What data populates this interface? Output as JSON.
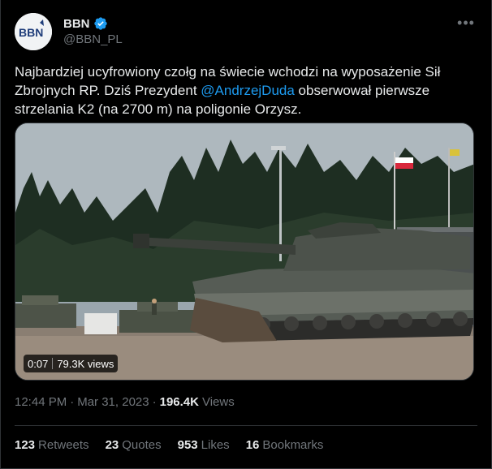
{
  "author": {
    "display_name": "BBN",
    "handle": "@BBN_PL",
    "avatar_text": "BBN"
  },
  "tweet": {
    "text_before": "Najbardziej ucyfrowiony czołg na świecie wchodzi na wyposażenie Sił Zbrojnych RP. Dziś Prezydent ",
    "mention": "@AndrzejDuda",
    "text_after": " obserwował pierwsze strzelania K2 (na 2700 m) na poligonie Orzysz."
  },
  "video": {
    "duration": "0:07",
    "views": "79.3K views"
  },
  "meta": {
    "time": "12:44 PM",
    "dot": "·",
    "date": "Mar 31, 2023",
    "dot2": "·",
    "views_count": "196.4K",
    "views_label": "Views"
  },
  "stats": [
    {
      "num": "123",
      "label": "Retweets"
    },
    {
      "num": "23",
      "label": "Quotes"
    },
    {
      "num": "953",
      "label": "Likes"
    },
    {
      "num": "16",
      "label": "Bookmarks"
    }
  ],
  "colors": {
    "accent": "#1d9bf0",
    "background": "#000000",
    "text": "#e7e9ea",
    "muted": "#71767b"
  }
}
